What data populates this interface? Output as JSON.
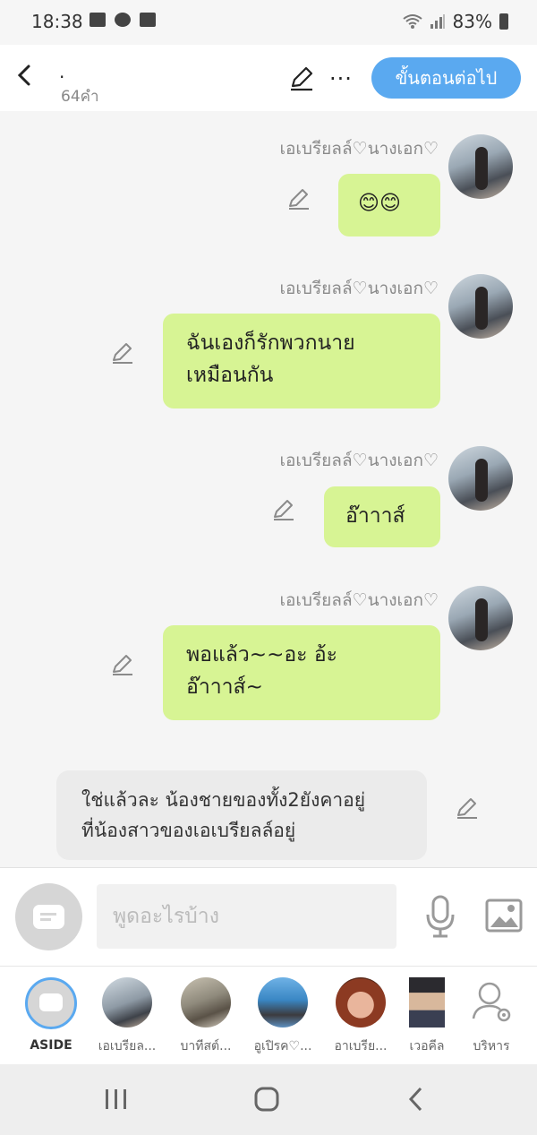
{
  "status_bar": {
    "time": "18:38",
    "battery": "83%"
  },
  "header": {
    "title": ".",
    "word_count": "64คำ",
    "next_button": "ขั้นตอนต่อไป"
  },
  "messages": [
    {
      "sender": "เอเบรียลล์♡นางเอก♡",
      "text_lines": [
        "😊😊"
      ]
    },
    {
      "sender": "เอเบรียลล์♡นางเอก♡",
      "text_lines": [
        "ฉันเองก็รักพวกนาย",
        "เหมือนกัน"
      ]
    },
    {
      "sender": "เอเบรียลล์♡นางเอก♡",
      "text_lines": [
        "อ๊าาาส์"
      ]
    },
    {
      "sender": "เอเบรียลล์♡นางเอก♡",
      "text_lines": [
        "พอแล้ว~~อะ อ้ะ",
        "อ๊าาาส์~"
      ]
    }
  ],
  "narration": {
    "text_lines": [
      "ใช่แล้วละ น้องชายของทั้ง2ยังคาอยู่",
      "ที่น้องสาวของเอเบรียลล์อยู่"
    ]
  },
  "composer": {
    "placeholder": "พูดอะไรบ้าง"
  },
  "characters": [
    {
      "label": "ASIDE",
      "active": true
    },
    {
      "label": "เอเบรียล...",
      "active": false
    },
    {
      "label": "บาทีสต์...",
      "active": false
    },
    {
      "label": "อูเปิรค♡...",
      "active": false
    },
    {
      "label": "อาเบรีย...",
      "active": false
    },
    {
      "label": "เวอคีล",
      "active": false
    },
    {
      "label": "บริหาร",
      "active": false
    }
  ],
  "colors": {
    "accent": "#5aa9f0",
    "bubble": "#d7f494",
    "narration_bubble": "#ebebeb"
  }
}
